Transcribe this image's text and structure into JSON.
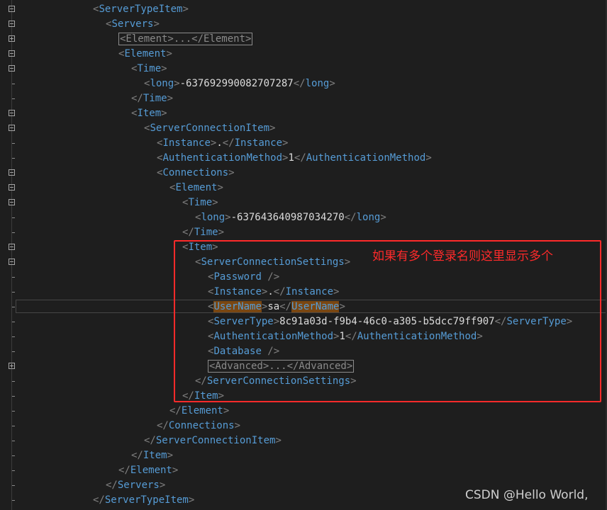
{
  "lines": [
    {
      "indent": 0,
      "fold": "minus",
      "tokens": [
        {
          "k": "b",
          "v": "<"
        },
        {
          "k": "t",
          "v": "ServerTypeItem"
        },
        {
          "k": "b",
          "v": ">"
        }
      ]
    },
    {
      "indent": 1,
      "fold": "minus",
      "tokens": [
        {
          "k": "b",
          "v": "<"
        },
        {
          "k": "t",
          "v": "Servers"
        },
        {
          "k": "b",
          "v": ">"
        }
      ]
    },
    {
      "indent": 2,
      "fold": "plus",
      "tokens": [
        {
          "k": "coll",
          "v": "<Element>...</Element>"
        }
      ]
    },
    {
      "indent": 2,
      "fold": "minus",
      "tokens": [
        {
          "k": "b",
          "v": "<"
        },
        {
          "k": "t",
          "v": "Element"
        },
        {
          "k": "b",
          "v": ">"
        }
      ]
    },
    {
      "indent": 3,
      "fold": "minus",
      "tokens": [
        {
          "k": "b",
          "v": "<"
        },
        {
          "k": "t",
          "v": "Time"
        },
        {
          "k": "b",
          "v": ">"
        }
      ]
    },
    {
      "indent": 4,
      "fold": "tick",
      "tokens": [
        {
          "k": "b",
          "v": "<"
        },
        {
          "k": "t",
          "v": "long"
        },
        {
          "k": "b",
          "v": ">"
        },
        {
          "k": "x",
          "v": "-637692990082707287"
        },
        {
          "k": "b",
          "v": "</"
        },
        {
          "k": "t",
          "v": "long"
        },
        {
          "k": "b",
          "v": ">"
        }
      ]
    },
    {
      "indent": 3,
      "fold": "tick",
      "tokens": [
        {
          "k": "b",
          "v": "</"
        },
        {
          "k": "t",
          "v": "Time"
        },
        {
          "k": "b",
          "v": ">"
        }
      ]
    },
    {
      "indent": 3,
      "fold": "minus",
      "tokens": [
        {
          "k": "b",
          "v": "<"
        },
        {
          "k": "t",
          "v": "Item"
        },
        {
          "k": "b",
          "v": ">"
        }
      ]
    },
    {
      "indent": 4,
      "fold": "minus",
      "tokens": [
        {
          "k": "b",
          "v": "<"
        },
        {
          "k": "t",
          "v": "ServerConnectionItem"
        },
        {
          "k": "b",
          "v": ">"
        }
      ]
    },
    {
      "indent": 5,
      "fold": "tick",
      "tokens": [
        {
          "k": "b",
          "v": "<"
        },
        {
          "k": "t",
          "v": "Instance"
        },
        {
          "k": "b",
          "v": ">"
        },
        {
          "k": "x",
          "v": "."
        },
        {
          "k": "b",
          "v": "</"
        },
        {
          "k": "t",
          "v": "Instance"
        },
        {
          "k": "b",
          "v": ">"
        }
      ]
    },
    {
      "indent": 5,
      "fold": "tick",
      "tokens": [
        {
          "k": "b",
          "v": "<"
        },
        {
          "k": "t",
          "v": "AuthenticationMethod"
        },
        {
          "k": "b",
          "v": ">"
        },
        {
          "k": "x",
          "v": "1"
        },
        {
          "k": "b",
          "v": "</"
        },
        {
          "k": "t",
          "v": "AuthenticationMethod"
        },
        {
          "k": "b",
          "v": ">"
        }
      ]
    },
    {
      "indent": 5,
      "fold": "minus",
      "tokens": [
        {
          "k": "b",
          "v": "<"
        },
        {
          "k": "t",
          "v": "Connections"
        },
        {
          "k": "b",
          "v": ">"
        }
      ]
    },
    {
      "indent": 6,
      "fold": "minus",
      "tokens": [
        {
          "k": "b",
          "v": "<"
        },
        {
          "k": "t",
          "v": "Element"
        },
        {
          "k": "b",
          "v": ">"
        }
      ]
    },
    {
      "indent": 7,
      "fold": "minus",
      "tokens": [
        {
          "k": "b",
          "v": "<"
        },
        {
          "k": "t",
          "v": "Time"
        },
        {
          "k": "b",
          "v": ">"
        }
      ]
    },
    {
      "indent": 8,
      "fold": "tick",
      "tokens": [
        {
          "k": "b",
          "v": "<"
        },
        {
          "k": "t",
          "v": "long"
        },
        {
          "k": "b",
          "v": ">"
        },
        {
          "k": "x",
          "v": "-637643640987034270"
        },
        {
          "k": "b",
          "v": "</"
        },
        {
          "k": "t",
          "v": "long"
        },
        {
          "k": "b",
          "v": ">"
        }
      ]
    },
    {
      "indent": 7,
      "fold": "tick",
      "tokens": [
        {
          "k": "b",
          "v": "</"
        },
        {
          "k": "t",
          "v": "Time"
        },
        {
          "k": "b",
          "v": ">"
        }
      ]
    },
    {
      "indent": 7,
      "fold": "minus",
      "tokens": [
        {
          "k": "b",
          "v": "<"
        },
        {
          "k": "t",
          "v": "Item"
        },
        {
          "k": "b",
          "v": ">"
        }
      ]
    },
    {
      "indent": 8,
      "fold": "minus",
      "tokens": [
        {
          "k": "b",
          "v": "<"
        },
        {
          "k": "t",
          "v": "ServerConnectionSettings"
        },
        {
          "k": "b",
          "v": ">"
        }
      ]
    },
    {
      "indent": 9,
      "fold": "tick",
      "tokens": [
        {
          "k": "b",
          "v": "<"
        },
        {
          "k": "t",
          "v": "Password"
        },
        {
          "k": "b",
          "v": " />"
        }
      ]
    },
    {
      "indent": 9,
      "fold": "tick",
      "tokens": [
        {
          "k": "b",
          "v": "<"
        },
        {
          "k": "t",
          "v": "Instance"
        },
        {
          "k": "b",
          "v": ">"
        },
        {
          "k": "x",
          "v": "."
        },
        {
          "k": "b",
          "v": "</"
        },
        {
          "k": "t",
          "v": "Instance"
        },
        {
          "k": "b",
          "v": ">"
        }
      ]
    },
    {
      "indent": 9,
      "fold": "tick",
      "current": true,
      "tokens": [
        {
          "k": "b",
          "v": "<"
        },
        {
          "k": "hl",
          "v": "UserName"
        },
        {
          "k": "b",
          "v": ">"
        },
        {
          "k": "x",
          "v": "sa"
        },
        {
          "k": "b",
          "v": "</"
        },
        {
          "k": "hl",
          "v": "UserName"
        },
        {
          "k": "b",
          "v": ">"
        }
      ]
    },
    {
      "indent": 9,
      "fold": "tick",
      "tokens": [
        {
          "k": "b",
          "v": "<"
        },
        {
          "k": "t",
          "v": "ServerType"
        },
        {
          "k": "b",
          "v": ">"
        },
        {
          "k": "x",
          "v": "8c91a03d-f9b4-46c0-a305-b5dcc79ff907"
        },
        {
          "k": "b",
          "v": "</"
        },
        {
          "k": "t",
          "v": "ServerType"
        },
        {
          "k": "b",
          "v": ">"
        }
      ]
    },
    {
      "indent": 9,
      "fold": "tick",
      "tokens": [
        {
          "k": "b",
          "v": "<"
        },
        {
          "k": "t",
          "v": "AuthenticationMethod"
        },
        {
          "k": "b",
          "v": ">"
        },
        {
          "k": "x",
          "v": "1"
        },
        {
          "k": "b",
          "v": "</"
        },
        {
          "k": "t",
          "v": "AuthenticationMethod"
        },
        {
          "k": "b",
          "v": ">"
        }
      ]
    },
    {
      "indent": 9,
      "fold": "tick",
      "tokens": [
        {
          "k": "b",
          "v": "<"
        },
        {
          "k": "t",
          "v": "Database"
        },
        {
          "k": "b",
          "v": " />"
        }
      ]
    },
    {
      "indent": 9,
      "fold": "plus",
      "tokens": [
        {
          "k": "coll",
          "v": "<Advanced>...</Advanced>"
        }
      ]
    },
    {
      "indent": 8,
      "fold": "tick",
      "tokens": [
        {
          "k": "b",
          "v": "</"
        },
        {
          "k": "t",
          "v": "ServerConnectionSettings"
        },
        {
          "k": "b",
          "v": ">"
        }
      ]
    },
    {
      "indent": 7,
      "fold": "tick",
      "tokens": [
        {
          "k": "b",
          "v": "</"
        },
        {
          "k": "t",
          "v": "Item"
        },
        {
          "k": "b",
          "v": ">"
        }
      ]
    },
    {
      "indent": 6,
      "fold": "tick",
      "tokens": [
        {
          "k": "b",
          "v": "</"
        },
        {
          "k": "t",
          "v": "Element"
        },
        {
          "k": "b",
          "v": ">"
        }
      ]
    },
    {
      "indent": 5,
      "fold": "tick",
      "tokens": [
        {
          "k": "b",
          "v": "</"
        },
        {
          "k": "t",
          "v": "Connections"
        },
        {
          "k": "b",
          "v": ">"
        }
      ]
    },
    {
      "indent": 4,
      "fold": "tick",
      "tokens": [
        {
          "k": "b",
          "v": "</"
        },
        {
          "k": "t",
          "v": "ServerConnectionItem"
        },
        {
          "k": "b",
          "v": ">"
        }
      ]
    },
    {
      "indent": 3,
      "fold": "tick",
      "tokens": [
        {
          "k": "b",
          "v": "</"
        },
        {
          "k": "t",
          "v": "Item"
        },
        {
          "k": "b",
          "v": ">"
        }
      ]
    },
    {
      "indent": 2,
      "fold": "tick",
      "tokens": [
        {
          "k": "b",
          "v": "</"
        },
        {
          "k": "t",
          "v": "Element"
        },
        {
          "k": "b",
          "v": ">"
        }
      ]
    },
    {
      "indent": 1,
      "fold": "tick",
      "tokens": [
        {
          "k": "b",
          "v": "</"
        },
        {
          "k": "t",
          "v": "Servers"
        },
        {
          "k": "b",
          "v": ">"
        }
      ]
    },
    {
      "indent": 0,
      "fold": "tick",
      "tokens": [
        {
          "k": "b",
          "v": "</"
        },
        {
          "k": "t",
          "v": "ServerTypeItem"
        },
        {
          "k": "b",
          "v": ">"
        }
      ]
    }
  ],
  "annotation": {
    "text": "如果有多个登录名则这里显示多个",
    "color": "#ff2a2a"
  },
  "watermark": "CSDN @Hello World,"
}
